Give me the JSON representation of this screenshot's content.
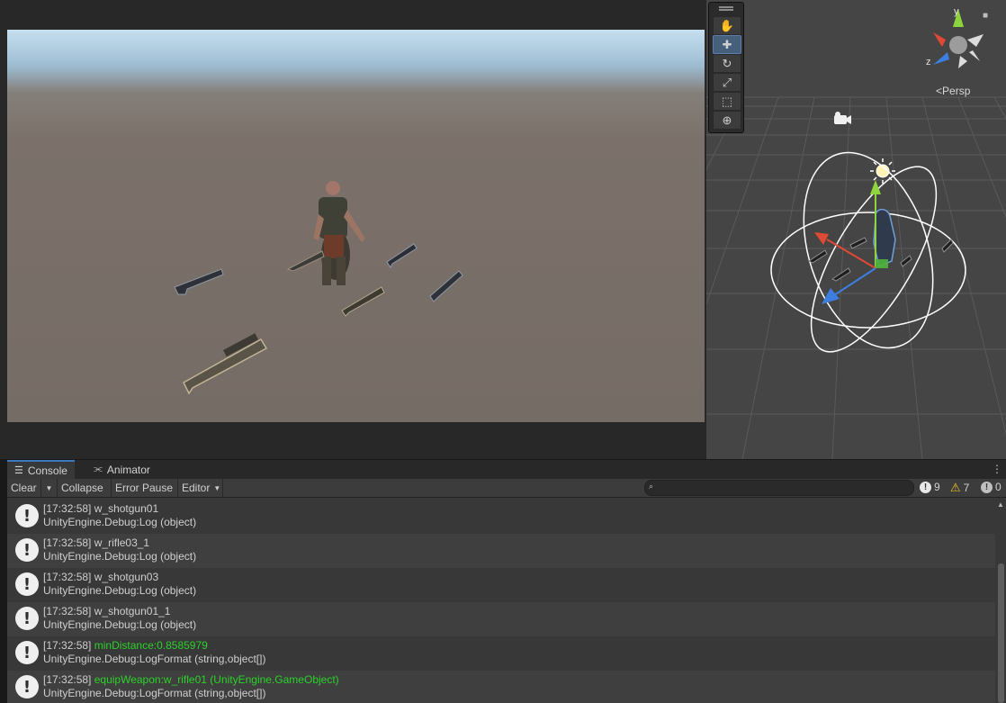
{
  "scene": {
    "view_mode": "Persp",
    "tools": [
      "hand-tool",
      "move-tool",
      "rotate-tool",
      "scale-tool",
      "rect-tool",
      "transform-tool"
    ],
    "active_tool": "move-tool",
    "gizmo_axes": {
      "y": "y",
      "z": "z"
    }
  },
  "console": {
    "tabs": [
      {
        "label": "Console",
        "icon": "console-icon",
        "active": true
      },
      {
        "label": "Animator",
        "icon": "animator-icon",
        "active": false
      }
    ],
    "toolbar": {
      "clear": "Clear",
      "collapse": "Collapse",
      "error_pause": "Error Pause",
      "editor": "Editor"
    },
    "counts": {
      "info": "9",
      "warning": "7",
      "error": "0"
    },
    "logs": [
      {
        "time": "[17:32:58]",
        "message": "w_shotgun01",
        "source": "UnityEngine.Debug:Log (object)",
        "highlight": false
      },
      {
        "time": "[17:32:58]",
        "message": "w_rifle03_1",
        "source": "UnityEngine.Debug:Log (object)",
        "highlight": false
      },
      {
        "time": "[17:32:58]",
        "message": "w_shotgun03",
        "source": "UnityEngine.Debug:Log (object)",
        "highlight": false
      },
      {
        "time": "[17:32:58]",
        "message": "w_shotgun01_1",
        "source": "UnityEngine.Debug:Log (object)",
        "highlight": false
      },
      {
        "time": "[17:32:58]",
        "message": "minDistance:0.8585979",
        "source": "UnityEngine.Debug:LogFormat (string,object[])",
        "highlight": true
      },
      {
        "time": "[17:32:58]",
        "message": "equipWeapon:w_rifle01 (UnityEngine.GameObject)",
        "source": "UnityEngine.Debug:LogFormat (string,object[])",
        "highlight": true
      }
    ]
  },
  "colors": {
    "highlight_text": "#2bd12b",
    "accent_tab": "#3a79bb",
    "active_tool": "#46607c"
  }
}
